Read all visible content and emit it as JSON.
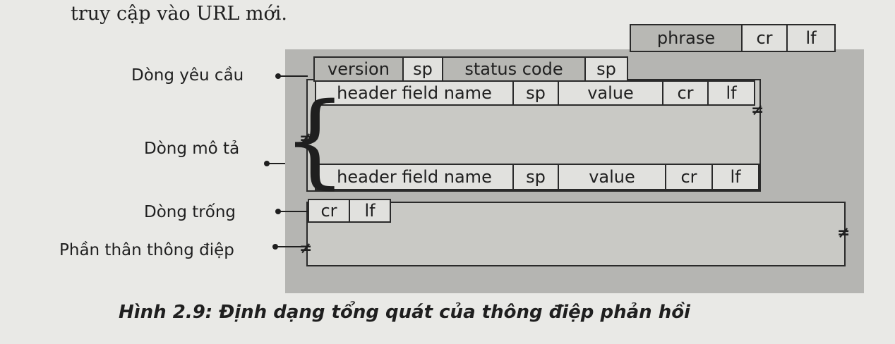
{
  "intro_text": "truy cập vào URL mới.",
  "labels": {
    "request_line": "Dòng yêu cầu",
    "description": "Dòng mô tả",
    "blank_line": "Dòng trống",
    "body": "Phần thân thông điệp"
  },
  "status_line": {
    "version": "version",
    "sp1": "sp",
    "status_code": "status code",
    "sp2": "sp",
    "phrase": "phrase",
    "cr": "cr",
    "lf": "lf"
  },
  "header_line_1": {
    "name": "header field name",
    "sp": "sp",
    "value": "value",
    "cr": "cr",
    "lf": "lf"
  },
  "header_line_2": {
    "name": "header field name",
    "sp": "sp",
    "value": "value",
    "cr": "cr",
    "lf": "lf"
  },
  "blank_row": {
    "cr": "cr",
    "lf": "lf"
  },
  "break_mark": "≠",
  "brace_mark": "{",
  "caption": "Hình 2.9: Định dạng tổng quát của thông điệp phản hồi"
}
